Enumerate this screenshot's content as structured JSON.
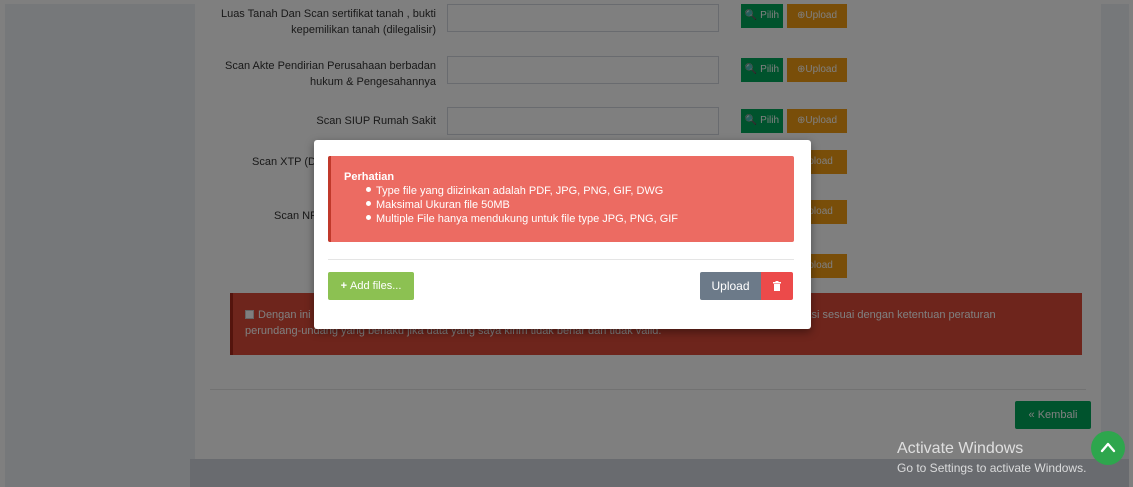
{
  "form": {
    "rows": [
      {
        "label": "Luas Tanah Dan Scan sertifikat tanah , bukti kepemilikan tanah (dilegalisir)",
        "pilih": "Pilih",
        "upload": "Upload"
      },
      {
        "label": "Scan Akte Pendirian Perusahaan berbadan hukum & Pengesahannya",
        "pilih": "Pilih",
        "upload": "Upload"
      },
      {
        "label": "Scan SIUP Rumah Sakit",
        "pilih": "Pilih",
        "upload": "Upload"
      },
      {
        "label": "Scan XTP (D",
        "pilih": "",
        "upload": "Upload"
      },
      {
        "label": "Scan NP",
        "pilih": "",
        "upload": "Upload"
      },
      {
        "label": "",
        "pilih": "",
        "upload": "Upload"
      }
    ],
    "consent_left": "Dengan ini",
    "consent_right": "ksi sesuai dengan ketentuan peraturan",
    "consent_line2": "perundang-undang yang berlaku jika data yang saya kirim tidak benar dan tidak valid.",
    "back_label": "Kembali"
  },
  "modal": {
    "alert_title": "Perhatian",
    "alert_items": [
      "Type file yang diizinkan adalah PDF, JPG, PNG, GIF, DWG",
      "Maksimal Ukuran file 50MB",
      "Multiple File hanya mendukung untuk file type JPG, PNG, GIF"
    ],
    "add_files_label": "Add files...",
    "upload_label": "Upload",
    "delete_icon": "trash-icon"
  },
  "watermark": {
    "title": "Activate Windows",
    "subtitle": "Go to Settings to activate Windows."
  },
  "colors": {
    "alert_bg": "#ec6b62",
    "consent_bg": "#dd4b39",
    "green": "#00a65a",
    "orange": "#f39c12",
    "add_files": "#8cc152",
    "upload_btn": "#6c7a89",
    "delete_btn": "#ec4a4a"
  }
}
